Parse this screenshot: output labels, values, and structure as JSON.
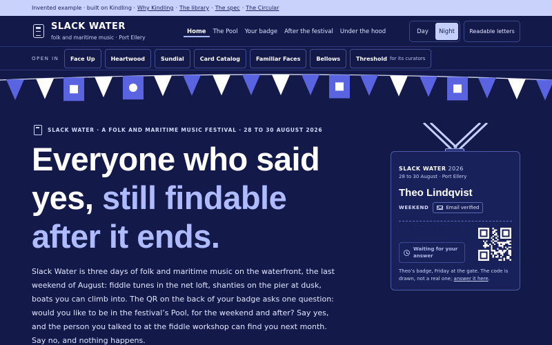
{
  "topbar": {
    "prefix": "Invented example · built on Kindling ·",
    "links": [
      "Why Kindling",
      "The library",
      "The spec",
      "The Circular"
    ]
  },
  "header": {
    "brand": "SLACK WATER",
    "brand_sub": "folk and maritime music · Port Ellery",
    "nav": [
      {
        "label": "Home",
        "active": true
      },
      {
        "label": "The Pool"
      },
      {
        "label": "Your badge"
      },
      {
        "label": "After the festival"
      },
      {
        "label": "Under the hood"
      }
    ],
    "mode": {
      "day": "Day",
      "night": "Night",
      "selected": "Night"
    },
    "readable": "Readable letters"
  },
  "openin": {
    "label": "OPEN IN",
    "chips": [
      {
        "label": "Face Up"
      },
      {
        "label": "Heartwood"
      },
      {
        "label": "Sundial"
      },
      {
        "label": "Card Catalog"
      },
      {
        "label": "Familiar Faces"
      },
      {
        "label": "Bellows"
      },
      {
        "label": "Threshold",
        "note": "for its curators"
      }
    ]
  },
  "eyebrow": "SLACK WATER · A FOLK AND MARITIME MUSIC FESTIVAL · 28 TO 30 AUGUST 2026",
  "hero": {
    "line1": "Everyone who said",
    "line2_plain": "yes,",
    "line2_accent": "still findable",
    "line3_accent": "after it ends."
  },
  "intro": "Slack Water is three days of folk and maritime music on the waterfront, the last weekend of August: fiddle tunes in the net loft, shanties on the pier at dusk, boats you can climb into. The QR on the back of your badge asks one question: would you like to be in the festival’s Pool, for the weekend and after? Say yes, and the person you talked to at the fiddle workshop can find you next month. Say no, and nothing happens.",
  "badge": {
    "title": "SLACK WATER",
    "year": "2026",
    "sub": "28 to 30 August · Port Ellery",
    "name": "Theo Lindqvist",
    "weekend": "WEEKEND",
    "verified": "Email verified",
    "waiting": "Waiting for your answer",
    "note": "Theo’s badge, Friday at the gate. The code is drawn, not a real one;",
    "note_link": "answer it here",
    "note_end": "."
  },
  "colors": {
    "page_bg": "#131a4a",
    "topbar_bg": "#c9d2fb",
    "accent": "#aebcff",
    "flag_blue": "#5a63e0",
    "flag_white": "#ffffff"
  }
}
